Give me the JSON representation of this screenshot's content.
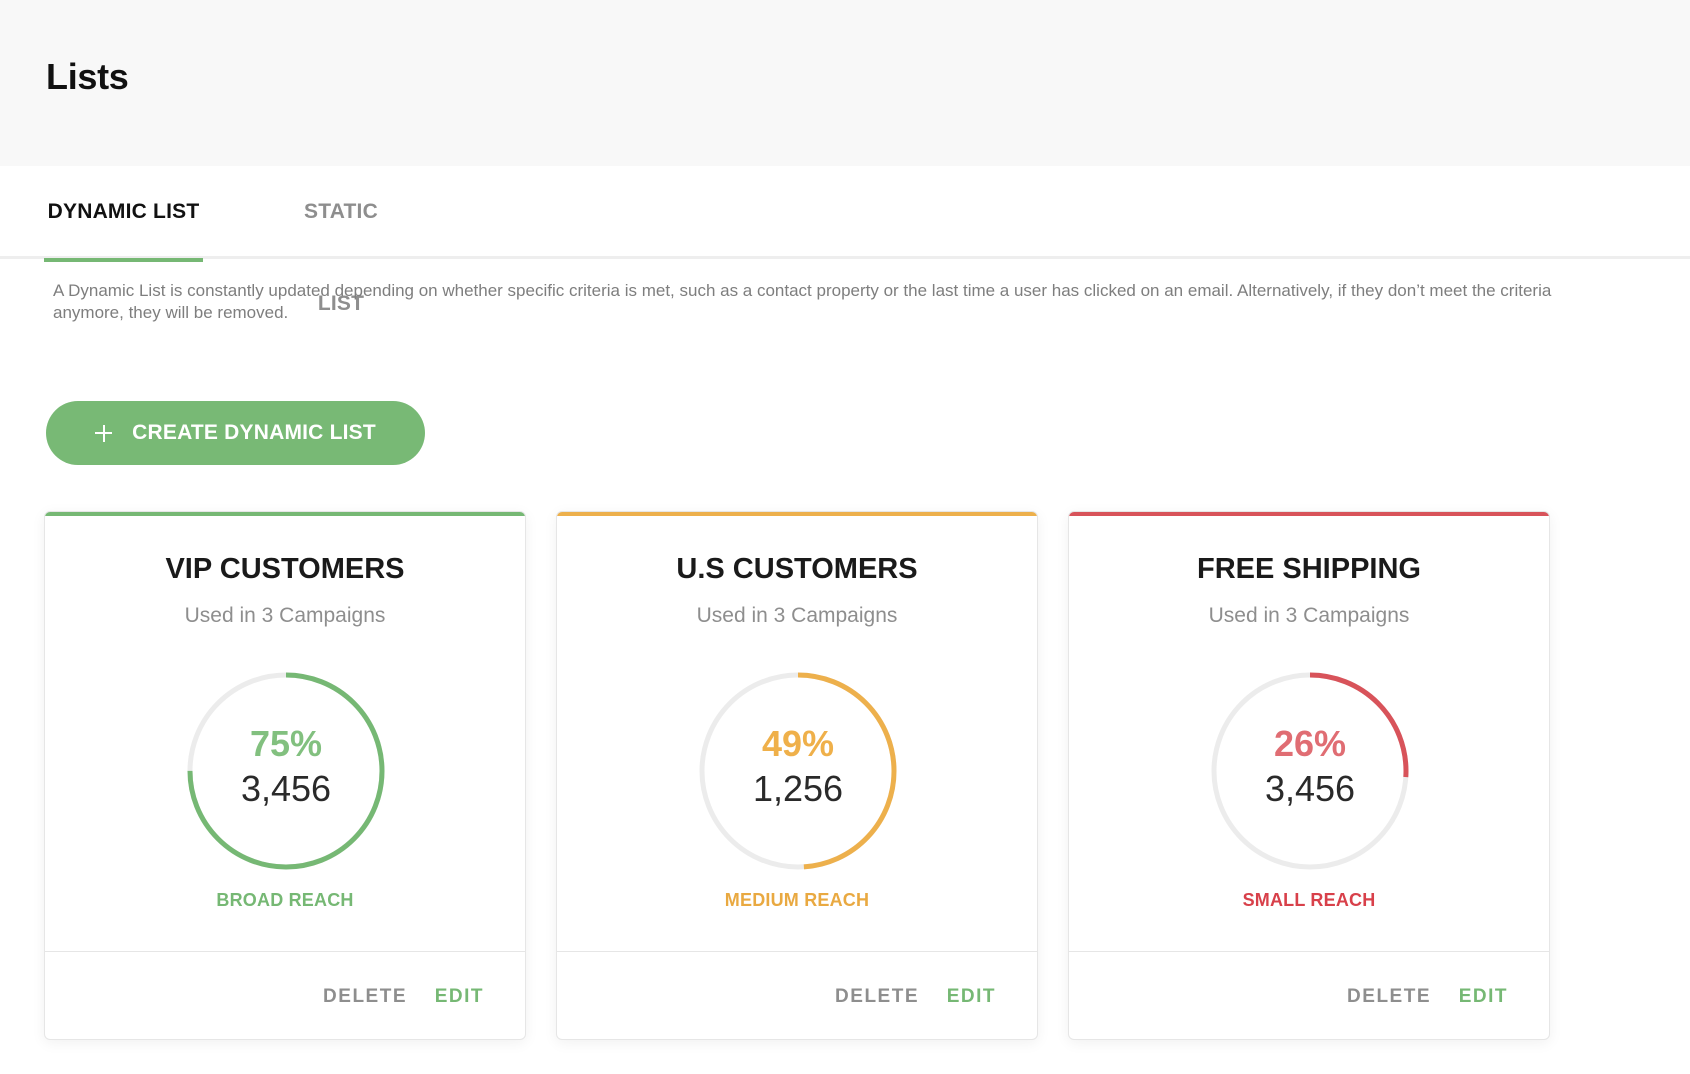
{
  "header": {
    "title": "Lists"
  },
  "tabs": [
    {
      "label": "DYNAMIC LIST",
      "active": true
    },
    {
      "label": "STATIC LIST",
      "active": false
    }
  ],
  "description": "A Dynamic List is constantly updated depending on whether specific criteria is met, such as a contact property or the last time a user has clicked on an email. Alternatively, if they don’t meet the criteria anymore, they will be removed.",
  "create_button": {
    "icon": "plus-icon",
    "label": "CREATE DYNAMIC LIST"
  },
  "colors": {
    "green": "#76b874",
    "orange": "#edb04c",
    "red": "#d8535a",
    "ring_track": "#ececec"
  },
  "cards": [
    {
      "title": "VIP CUSTOMERS",
      "subtitle": "Used in 3 Campaigns",
      "percent_label": "75%",
      "percent_value": 0.75,
      "count": "3,456",
      "reach": "BROAD REACH",
      "accent_color": "#76b874",
      "percent_color": "#82c07f",
      "reach_color": "#76b874",
      "delete_label": "DELETE",
      "edit_label": "EDIT"
    },
    {
      "title": "U.S CUSTOMERS",
      "subtitle": "Used in 3 Campaigns",
      "percent_label": "49%",
      "percent_value": 0.49,
      "count": "1,256",
      "reach": "MEDIUM REACH",
      "accent_color": "#edb04c",
      "percent_color": "#efb04a",
      "reach_color": "#e9a941",
      "delete_label": "DELETE",
      "edit_label": "EDIT"
    },
    {
      "title": "FREE SHIPPING",
      "subtitle": "Used in 3 Campaigns",
      "percent_label": "26%",
      "percent_value": 0.26,
      "count": "3,456",
      "reach": "SMALL REACH",
      "accent_color": "#d8535a",
      "percent_color": "#e06d73",
      "reach_color": "#d8404a",
      "delete_label": "DELETE",
      "edit_label": "EDIT"
    }
  ]
}
